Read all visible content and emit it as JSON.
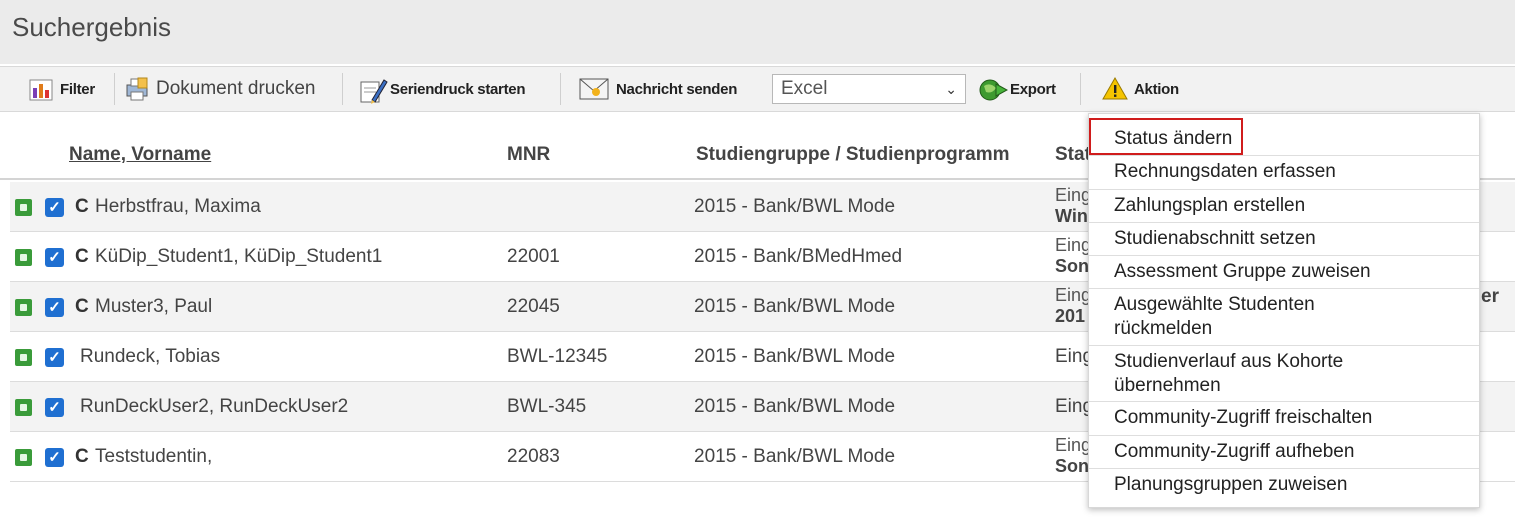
{
  "page": {
    "title": "Suchergebnis"
  },
  "toolbar": {
    "filter": "Filter",
    "print": "Dokument drucken",
    "mailmerge": "Seriendruck starten",
    "message": "Nachricht senden",
    "format_select": "Excel",
    "export": "Export",
    "action": "Aktion"
  },
  "table": {
    "headers": {
      "name": "Name, Vorname",
      "mnr": "MNR",
      "group": "Studiengruppe / Studienprogramm",
      "status": "Stat"
    },
    "rows": [
      {
        "flag": "C",
        "name": "Herbstfrau, Maxima",
        "mnr": "",
        "group": "2015 - Bank/BWL Mode",
        "status_line1": "Eing",
        "status_line2": "Win"
      },
      {
        "flag": "C",
        "name": "KüDip_Student1, KüDip_Student1",
        "mnr": "22001",
        "group": "2015 - Bank/BMedHmed",
        "status_line1": "Eing",
        "status_line2": "Son"
      },
      {
        "flag": "C",
        "name": "Muster3, Paul",
        "mnr": "22045",
        "group": "2015 - Bank/BWL Mode",
        "status_line1": "Eing",
        "status_line2": "201"
      },
      {
        "flag": "",
        "name": "Rundeck, Tobias",
        "mnr": "BWL-12345",
        "group": "2015 - Bank/BWL Mode",
        "status_line1": "Eing",
        "status_line2": ""
      },
      {
        "flag": "",
        "name": "RunDeckUser2, RunDeckUser2",
        "mnr": "BWL-345",
        "group": "2015 - Bank/BWL Mode",
        "status_line1": "Eing",
        "status_line2": ""
      },
      {
        "flag": "C",
        "name": "Teststudentin,",
        "mnr": "22083",
        "group": "2015 - Bank/BWL Mode",
        "status_line1": "Eing",
        "status_line2": "Son"
      }
    ],
    "overflow_text": "er"
  },
  "action_menu": {
    "items": [
      {
        "l1": "Status ändern",
        "l2": ""
      },
      {
        "l1": "Rechnungsdaten erfassen",
        "l2": ""
      },
      {
        "l1": "Zahlungsplan erstellen",
        "l2": ""
      },
      {
        "l1": "Studienabschnitt setzen",
        "l2": ""
      },
      {
        "l1": "Assessment Gruppe zuweisen",
        "l2": ""
      },
      {
        "l1": "Ausgewählte Studenten",
        "l2": "rückmelden"
      },
      {
        "l1": "Studienverlauf aus Kohorte",
        "l2": "übernehmen"
      },
      {
        "l1": "Community-Zugriff freischalten",
        "l2": ""
      },
      {
        "l1": "Community-Zugriff aufheben",
        "l2": ""
      },
      {
        "l1": "Planungsgruppen zuweisen",
        "l2": ""
      }
    ]
  },
  "colors": {
    "highlight": "#d01c1c",
    "accent_check": "#1f6fd1",
    "status_green": "#3a9b3a"
  },
  "icons": {
    "filter": "filter-chart-icon",
    "print": "printer-document-icon",
    "mailmerge": "mailmerge-pen-icon",
    "message": "envelope-icon",
    "export": "export-globe-icon",
    "action": "warning-triangle-icon"
  }
}
